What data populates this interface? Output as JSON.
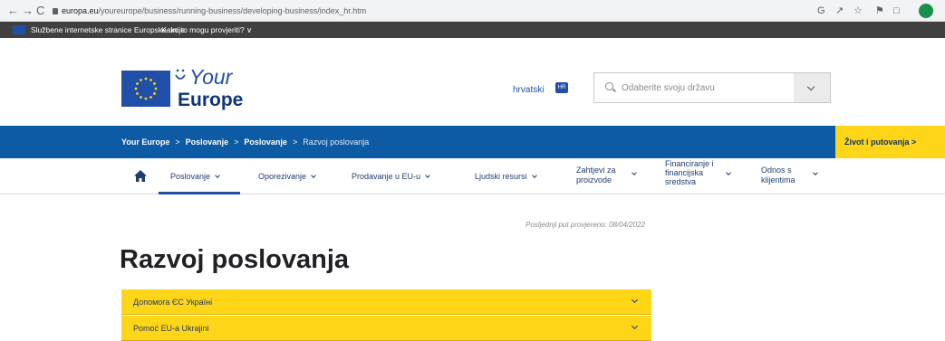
{
  "browser": {
    "back": "←",
    "forward": "→",
    "reload": "C",
    "url_host": "europa.eu",
    "url_path": "/youreurope/business/running-business/developing-business/index_hr.htm",
    "ext1": "G",
    "ext2": "↗",
    "ext3": "☆",
    "ext4": "⚑",
    "ext5": "□"
  },
  "eu_bar": {
    "official": "Službene internetske stranice Europske unije",
    "verify": "Kako to mogu provjeriti? ∨"
  },
  "header": {
    "logo_your": "Your",
    "logo_europe": "Europe",
    "language": "hrvatski",
    "language_code": "HR",
    "country_placeholder": "Odaberite svoju državu"
  },
  "breadcrumb": {
    "items": [
      "Your Europe",
      "Poslovanje",
      "Poslovanje"
    ],
    "separator": ">",
    "current": "Razvoj poslovanja",
    "life_button": "Život i putovanja >"
  },
  "mainnav": {
    "items": [
      {
        "label": "Poslovanje"
      },
      {
        "label": "Oporezivanje"
      },
      {
        "label": "Prodavanje u EU-u"
      },
      {
        "label": "Ljudski resursi"
      },
      {
        "label_line1": "Zahtjevi za",
        "label_line2": "proizvode"
      },
      {
        "label_line1": "Financiranje i",
        "label_line2": "financijska",
        "label_line3": "sredstva"
      },
      {
        "label_line1": "Odnos s",
        "label_line2": "klijentima"
      }
    ]
  },
  "main": {
    "updated": "Posljednji put provjereno: 08/04/2022",
    "title": "Razvoj poslovanja",
    "accordion": [
      {
        "label": "Допомога ЄС Україні"
      },
      {
        "label": "Pomoć EU-a Ukrajini"
      }
    ]
  },
  "colors": {
    "brand_blue": "#0d5ba4",
    "accent_yellow": "#ffd617",
    "logo_blue": "#1f4fa8"
  }
}
